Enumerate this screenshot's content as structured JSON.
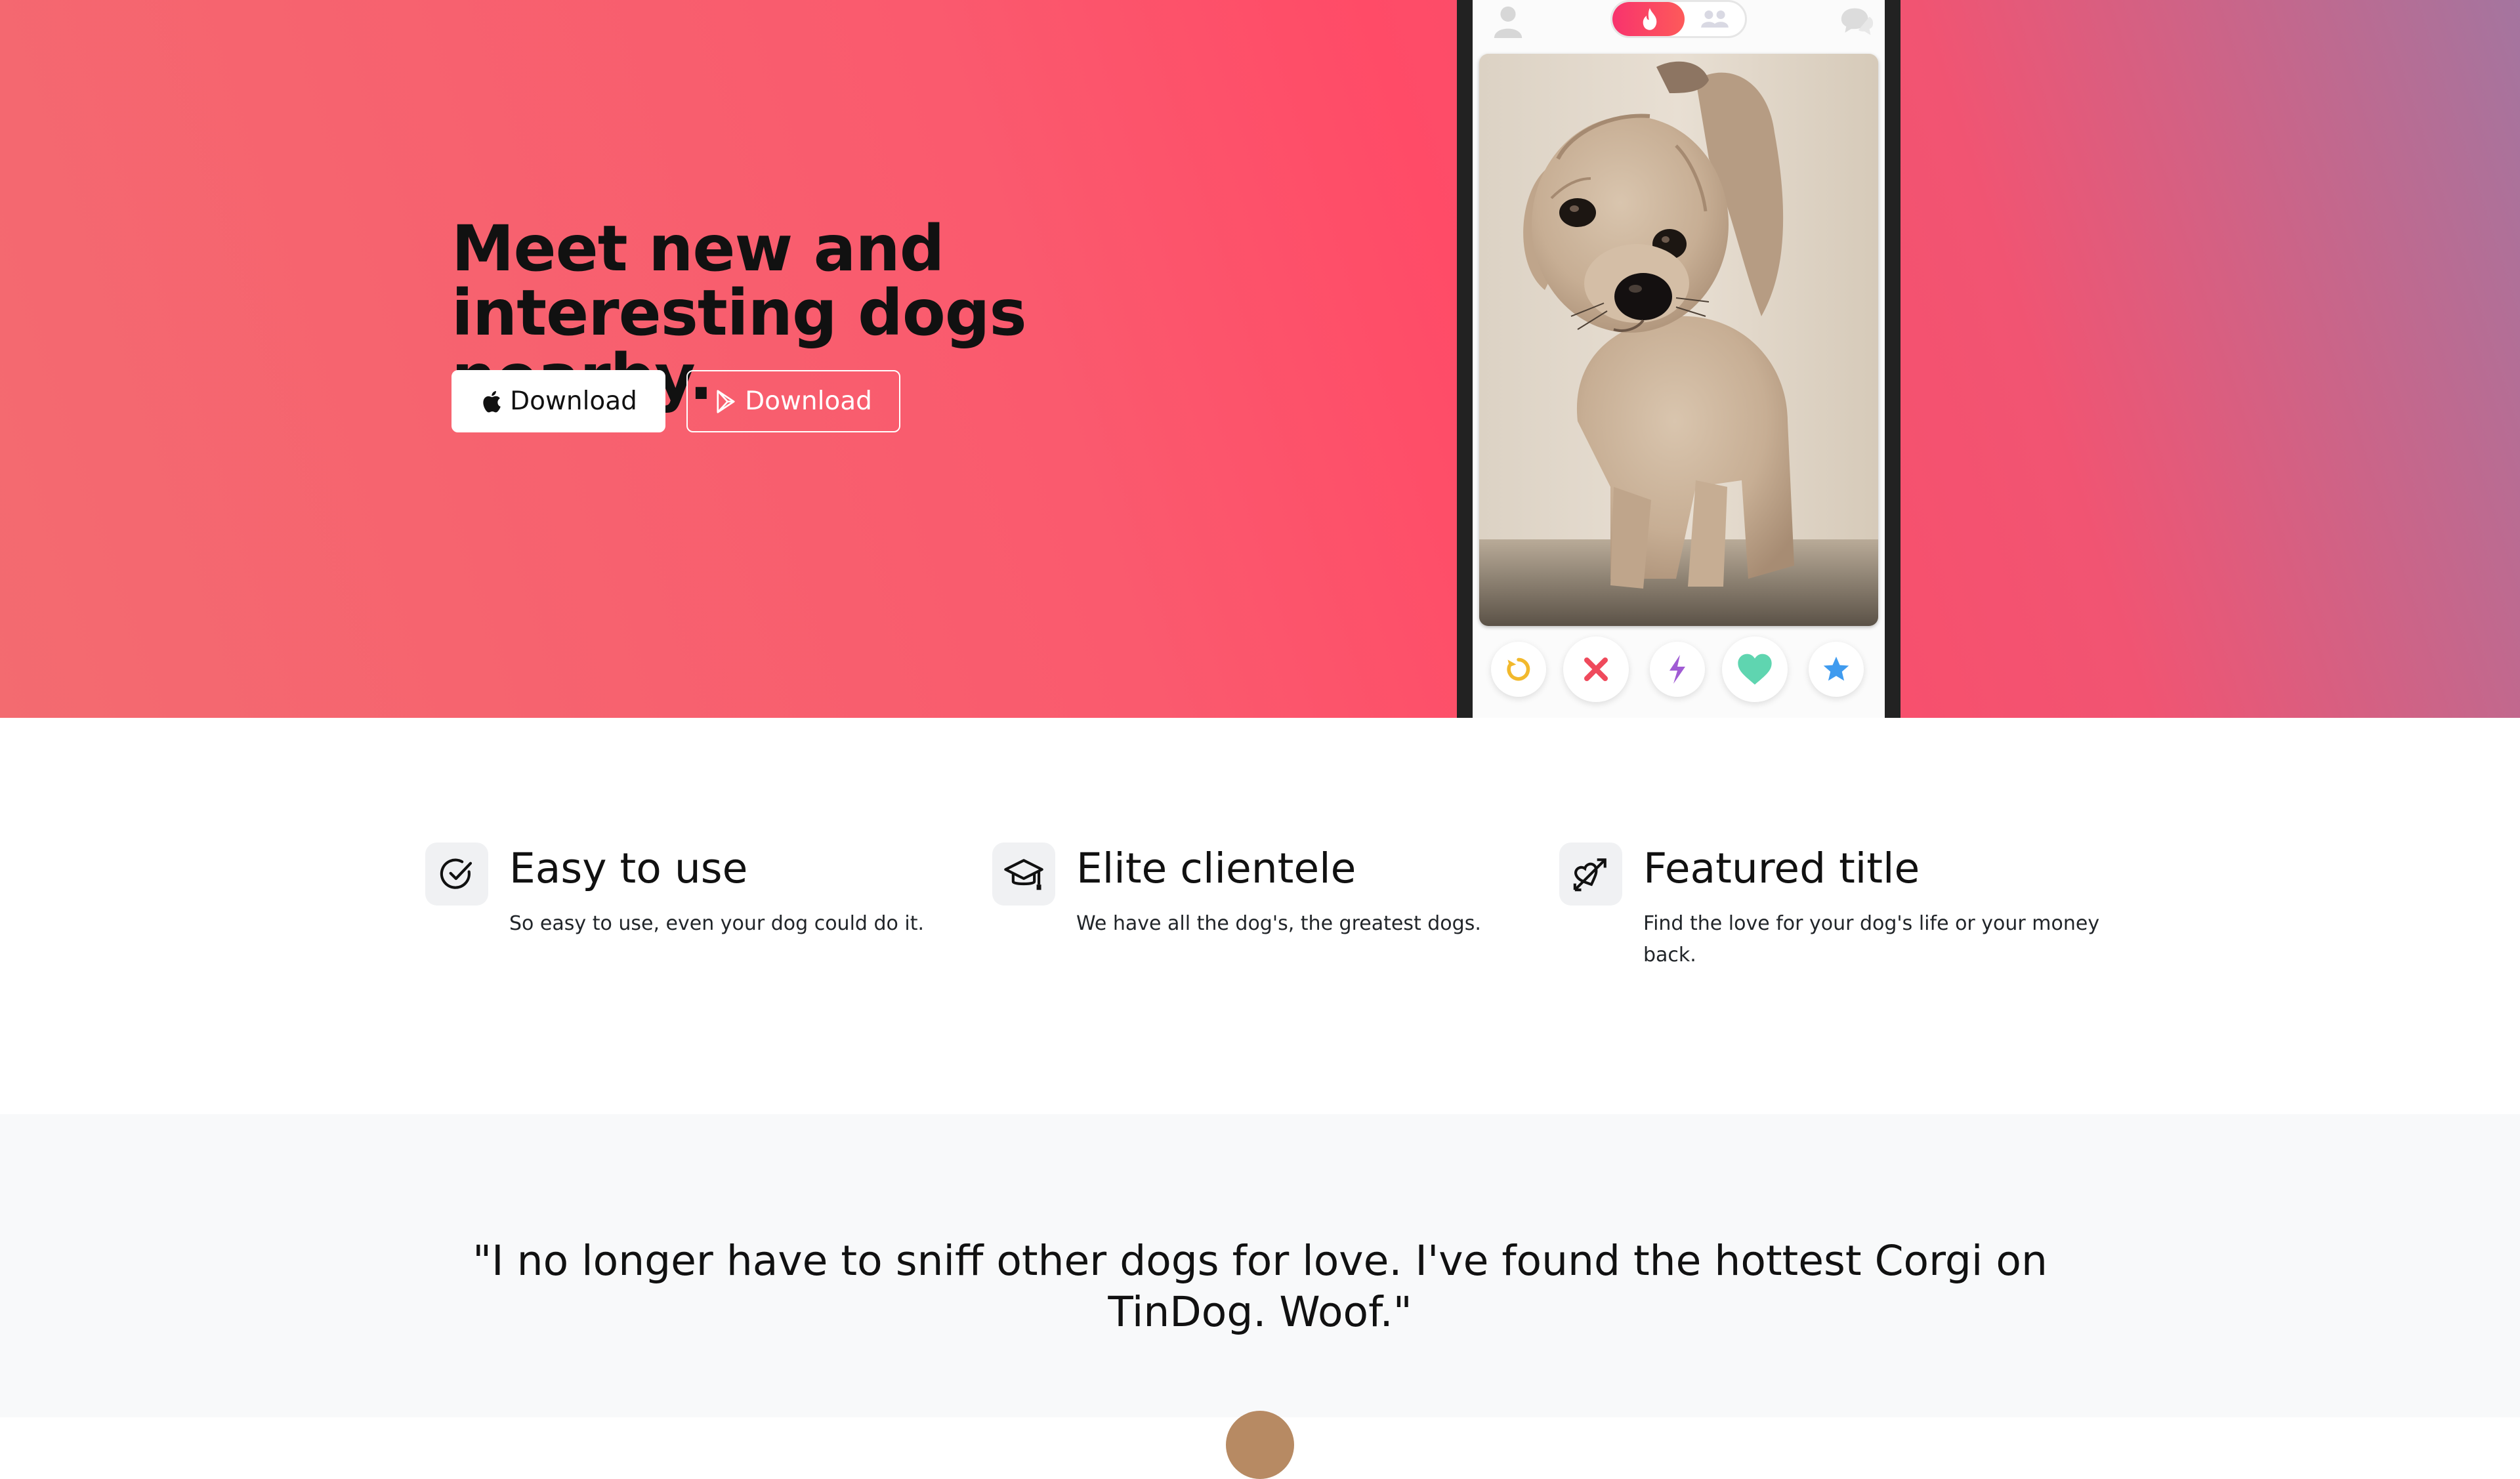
{
  "hero": {
    "title": "Meet new and interesting dogs nearby.",
    "buttons": {
      "apple_label": "Download",
      "play_label": "Download"
    },
    "gradient_colors": [
      "#f36b70",
      "#ff4b67",
      "#a4759f"
    ]
  },
  "phone": {
    "action_icons": [
      "rewind-icon",
      "nope-icon",
      "boost-icon",
      "like-icon",
      "superlike-icon"
    ],
    "action_colors": {
      "rewind": "#f2b92c",
      "nope": "#ef4a5c",
      "boost": "#a05bd4",
      "like": "#5fd5b0",
      "superlike": "#3f9bef"
    }
  },
  "features": [
    {
      "icon": "check-circle-icon",
      "title": "Easy to use",
      "text": "So easy to use, even your dog could do it."
    },
    {
      "icon": "graduation-cap-icon",
      "title": "Elite clientele",
      "text": "We have all the dog's, the greatest dogs."
    },
    {
      "icon": "heart-arrow-icon",
      "title": "Featured title",
      "text": "Find the love for your dog's life or your money back."
    }
  ],
  "testimonial": {
    "quote": "\"I no longer have to sniff other dogs for love. I've found the hottest Corgi on TinDog. Woof.\""
  }
}
